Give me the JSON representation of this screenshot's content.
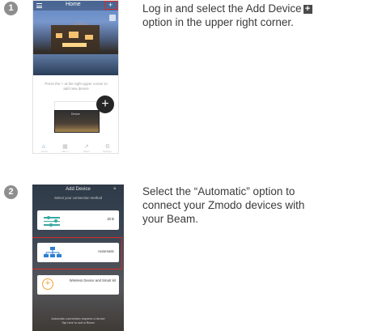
{
  "steps": [
    {
      "number": "1",
      "text_line1": "Log in and select the Add Device",
      "text_line2": "option in the upper right corner.",
      "inline_icon": "+",
      "phone": {
        "title": "Home",
        "add_symbol": "+",
        "caption": "Press the + at the right upper corner to add new device",
        "card_label": "Device",
        "fab_symbol": "+",
        "tabs": [
          "Home",
          "Album",
          "Share",
          "Settings"
        ]
      }
    },
    {
      "number": "2",
      "text_line1": "Select the “Automatic” option to",
      "text_line2": "connect your Zmodo devices with",
      "text_line3": "your Beam.",
      "phone": {
        "title": "Add Device",
        "close_symbol": "×",
        "subtitle": "Select your connection method",
        "options": [
          "Zink",
          "Automatic",
          "Wireless Device and Smart kit"
        ],
        "plus_symbol": "+",
        "footer_line1": "Automatic connection requires a device",
        "footer_line2": "Tap here to add a Beam"
      }
    }
  ],
  "colors": {
    "badge": "#8e8e8e",
    "highlight": "#d62b2b",
    "accent_teal": "#3aa8a0",
    "accent_blue": "#2d7fd0",
    "accent_orange": "#f2a33a"
  },
  "icons": [
    "menu-icon",
    "add-icon",
    "camera-icon",
    "home-icon",
    "album-icon",
    "share-icon",
    "settings-icon",
    "close-icon",
    "sliders-icon",
    "network-icon",
    "plus-circle-icon"
  ]
}
